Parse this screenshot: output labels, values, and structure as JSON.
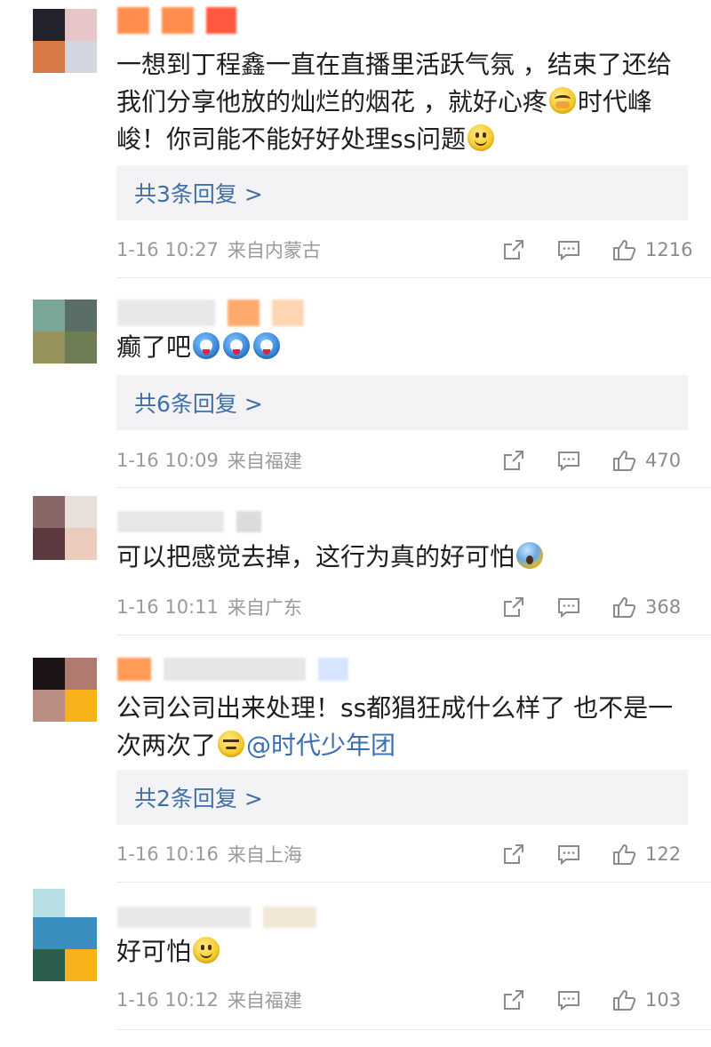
{
  "comments": [
    {
      "text_parts": [
        "一想到丁程鑫一直在直播里活跃气氛 ，结束了还给我们分享他放的灿烂的烟花 ，就好心疼",
        "时代峰峻！你司能不能好好处理ss问题"
      ],
      "replies": "共3条回复 >",
      "time": "1-16 10:27",
      "location": "来自内蒙古",
      "likes": "1216"
    },
    {
      "text_parts": [
        "癫了吧"
      ],
      "replies": "共6条回复 >",
      "time": "1-16 10:09",
      "location": "来自福建",
      "likes": "470"
    },
    {
      "text_parts": [
        "可以把感觉去掉，这行为真的好可怕"
      ],
      "time": "1-16 10:11",
      "location": "来自广东",
      "likes": "368"
    },
    {
      "text_parts": [
        "公司公司出来处理！ss都猖狂成什么样了 也不是一次两次了",
        "@时代少年团"
      ],
      "replies": "共2条回复 >",
      "time": "1-16 10:16",
      "location": "来自上海",
      "likes": "122"
    },
    {
      "text_parts": [
        "好可怕"
      ],
      "time": "1-16 10:12",
      "location": "来自福建",
      "likes": "103"
    }
  ],
  "icons": {
    "share": "share-icon",
    "comment": "comment-icon",
    "like": "thumbs-up-icon"
  },
  "colors": {
    "link": "#3f6fa8",
    "meta_text": "#9a9a9a",
    "reply_bg": "#f3f3f5"
  }
}
